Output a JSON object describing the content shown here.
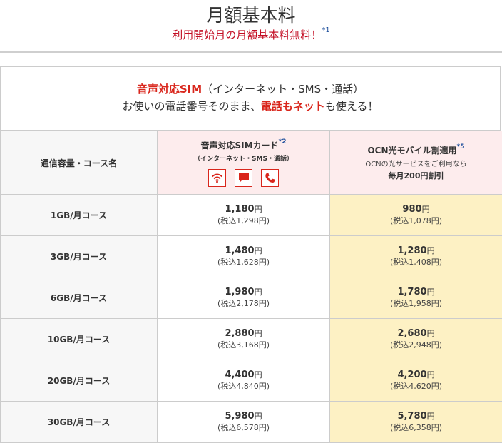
{
  "header": {
    "title": "月額基本料",
    "subtitle": "利用開始月の月額基本料無料！",
    "subtitle_note": "*1"
  },
  "intro": {
    "line1_strong": "音声対応SIM",
    "line1_rest": "（インターネット・SMS・通話）",
    "line2_pre": "お使いの電話番号そのまま、",
    "line2_strong": "電話もネット",
    "line2_post": "も使える！"
  },
  "table": {
    "corner_label": "通信容量・コース名",
    "col_sim": {
      "title": "音声対応SIMカード",
      "note_mark": "*2",
      "subtitle": "（インターネット・SMS・通話）",
      "icons": [
        "wifi-icon",
        "sms-icon",
        "phone-icon"
      ]
    },
    "col_ocn": {
      "title": "OCN光モバイル割適用",
      "note_mark": "*5",
      "note": "OCNの光サービスをご利用なら",
      "strong": "毎月200円割引"
    },
    "yen": "円",
    "rows": [
      {
        "course": "1GB/月コース",
        "sim_price": "1,180",
        "sim_tax": "(税込1,298円)",
        "ocn_price": "980",
        "ocn_tax": "(税込1,078円)"
      },
      {
        "course": "3GB/月コース",
        "sim_price": "1,480",
        "sim_tax": "(税込1,628円)",
        "ocn_price": "1,280",
        "ocn_tax": "(税込1,408円)"
      },
      {
        "course": "6GB/月コース",
        "sim_price": "1,980",
        "sim_tax": "(税込2,178円)",
        "ocn_price": "1,780",
        "ocn_tax": "(税込1,958円)"
      },
      {
        "course": "10GB/月コース",
        "sim_price": "2,880",
        "sim_tax": "(税込3,168円)",
        "ocn_price": "2,680",
        "ocn_tax": "(税込2,948円)"
      },
      {
        "course": "20GB/月コース",
        "sim_price": "4,400",
        "sim_tax": "(税込4,840円)",
        "ocn_price": "4,200",
        "ocn_tax": "(税込4,620円)"
      },
      {
        "course": "30GB/月コース",
        "sim_price": "5,980",
        "sim_tax": "(税込6,578円)",
        "ocn_price": "5,780",
        "ocn_tax": "(税込6,358円)"
      }
    ]
  },
  "colors": {
    "accent_red": "#d9261c",
    "header_pink": "#fdeced",
    "highlight_yellow": "#fdf1c4",
    "note_blue": "#1b4d9b"
  }
}
